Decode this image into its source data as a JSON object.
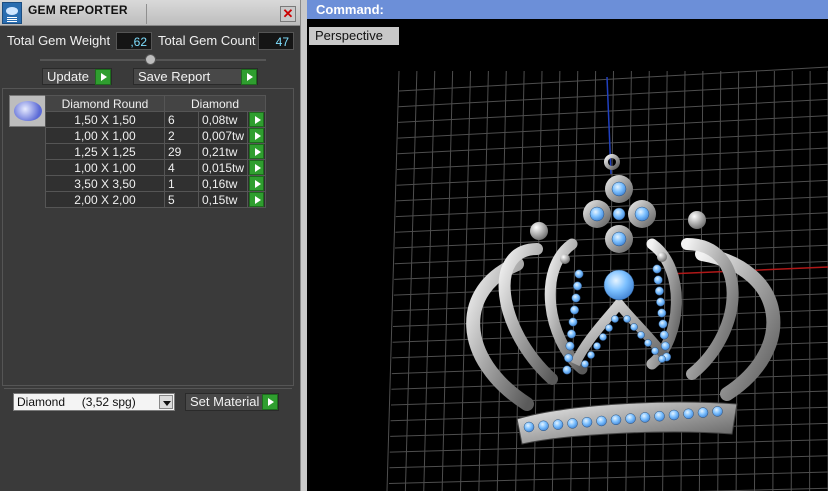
{
  "panel": {
    "title": "GEM REPORTER",
    "close_glyph": "✕",
    "total_weight_label": "Total Gem Weight",
    "total_weight_value": ",62",
    "total_count_label": "Total Gem Count",
    "total_count_value": "47",
    "update_label": "Update",
    "save_report_label": "Save Report",
    "table": {
      "headers": [
        "Diamond Round",
        "Diamond"
      ],
      "rows": [
        {
          "size": "1,50 X 1,50",
          "count": "6",
          "weight": "0,08tw"
        },
        {
          "size": "1,00 X 1,00",
          "count": "2",
          "weight": "0,007tw"
        },
        {
          "size": "1,25 X 1,25",
          "count": "29",
          "weight": "0,21tw"
        },
        {
          "size": "1,00 X 1,00",
          "count": "4",
          "weight": "0,015tw"
        },
        {
          "size": "3,50 X 3,50",
          "count": "1",
          "weight": "0,16tw"
        },
        {
          "size": "2,00 X 2,00",
          "count": "5",
          "weight": "0,15tw"
        }
      ]
    },
    "material_select": "Diamond     (3,52 spg)",
    "set_material_label": "Set Material",
    "icons": [
      "gem-reporter-icon",
      "close-icon",
      "play-icon",
      "diamond-gem-icon",
      "chevron-down-icon"
    ]
  },
  "viewport": {
    "command_label": "Command:",
    "tab_label": "Perspective",
    "colors": {
      "grid": "#5a5a5a",
      "x_axis": "#b01818",
      "y_axis": "#2040c0",
      "metal": "#b9b9b9",
      "gem": "#7cc0ff"
    }
  }
}
